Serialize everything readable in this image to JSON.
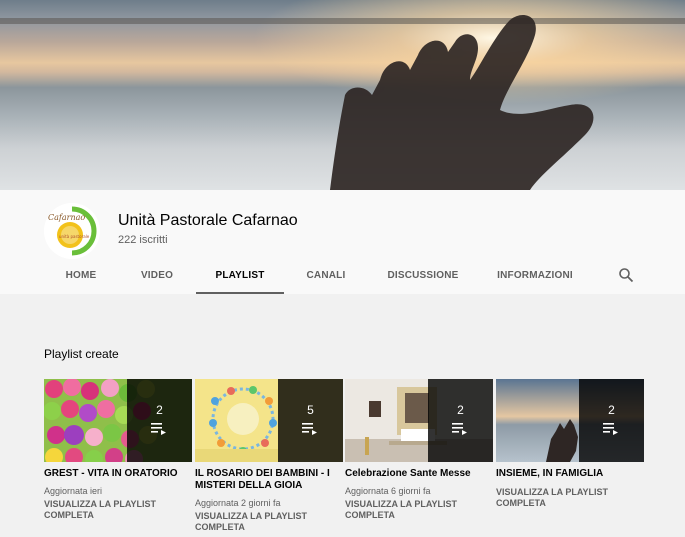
{
  "channel": {
    "name": "Unità Pastorale Cafarnao",
    "subscribers": "222 iscritti",
    "logo_text_top": "Cafarnao",
    "logo_text_inner": "unità pastorale"
  },
  "tabs": [
    {
      "label": "HOME",
      "active": false
    },
    {
      "label": "VIDEO",
      "active": false
    },
    {
      "label": "PLAYLIST",
      "active": true
    },
    {
      "label": "CANALI",
      "active": false
    },
    {
      "label": "DISCUSSIONE",
      "active": false
    },
    {
      "label": "INFORMAZIONI",
      "active": false
    }
  ],
  "search_icon": "search-icon",
  "section": {
    "title": "Playlist create"
  },
  "playlists": [
    {
      "title": "GREST - VITA IN ORATORIO",
      "count": "2",
      "updated": "Aggiornata ieri",
      "link": "VISUALIZZA LA PLAYLIST COMPLETA"
    },
    {
      "title": "IL ROSARIO DEI BAMBINI - I MISTERI DELLA GIOIA",
      "count": "5",
      "updated": "Aggiornata 2 giorni fa",
      "link": "VISUALIZZA LA PLAYLIST COMPLETA"
    },
    {
      "title": "Celebrazione Sante Messe",
      "count": "2",
      "updated": "Aggiornata 6 giorni fa",
      "link": "VISUALIZZA LA PLAYLIST COMPLETA"
    },
    {
      "title": "INSIEME, IN FAMIGLIA",
      "count": "2",
      "updated": "",
      "link": "VISUALIZZA LA PLAYLIST COMPLETA"
    }
  ],
  "colors": {
    "accent_logo_green": "#6abf3a",
    "accent_logo_yellow": "#f2c21b",
    "tab_indicator": "#606060"
  }
}
